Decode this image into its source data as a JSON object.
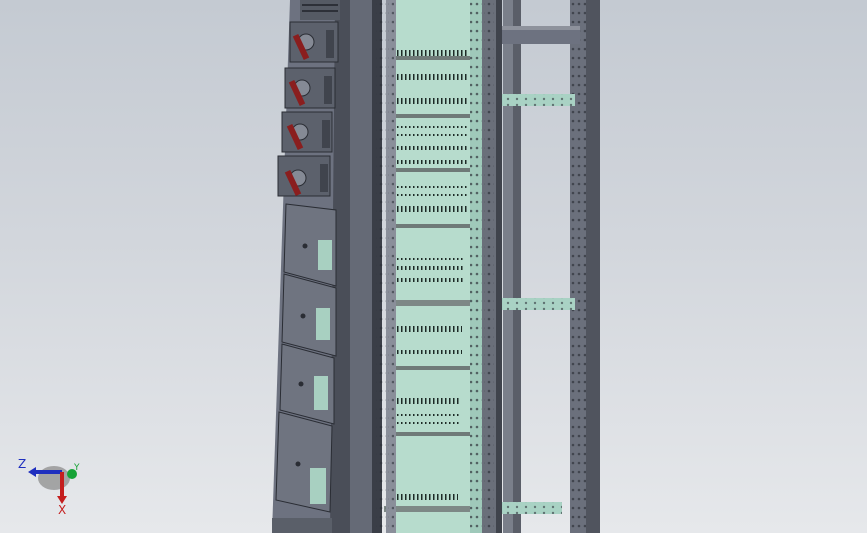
{
  "viewport": {
    "background_top": "#c4cad2",
    "background_bottom": "#e6e8eb"
  },
  "model": {
    "frame_color": "#5f6470",
    "frame_dark": "#3a3e47",
    "panel_color": "#b7dccd",
    "drawer_color": "#6d7280",
    "handle_accent": "#8a1e1e"
  },
  "triad": {
    "z_label": "Z",
    "y_label": "Y",
    "x_label": "X",
    "z_color": "#1f2fbf",
    "y_color": "#17a337",
    "x_color": "#c41e1e"
  }
}
